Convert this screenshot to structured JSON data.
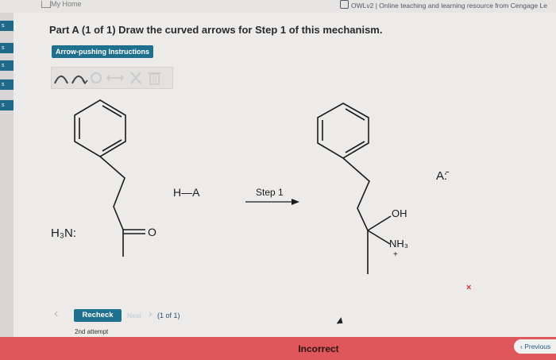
{
  "browser": {
    "home_label": "My Home",
    "tab_title": "OWLv2 | Online teaching and learning resource from Cengage Le"
  },
  "sidebar": {
    "items": [
      "s",
      "s",
      "s",
      "s",
      "s"
    ]
  },
  "problem": {
    "title": "Part A (1 of 1) Draw the curved arrows for Step 1 of this mechanism.",
    "instructions_button": "Arrow-pushing Instructions"
  },
  "toolbar": {
    "tools": [
      "curved-arrow-tool",
      "single-electron-arrow-tool",
      "bond-tool",
      "resonance-arrow-tool",
      "delete-tool",
      "trash-tool"
    ]
  },
  "mechanism": {
    "amine": "H₃N:",
    "acid": "H—A",
    "oxygen": "O",
    "step_label": "Step 1",
    "oh": "OH",
    "nh3": "NH₃",
    "plus": "+",
    "base": "A:̄"
  },
  "controls": {
    "recheck": "Recheck",
    "next": "Next",
    "page": "(1 of 1)",
    "attempt": "2nd attempt",
    "status": "Incorrect",
    "previous": "Previous"
  },
  "colors": {
    "accent": "#1f6f8f",
    "error": "#e0575b"
  }
}
